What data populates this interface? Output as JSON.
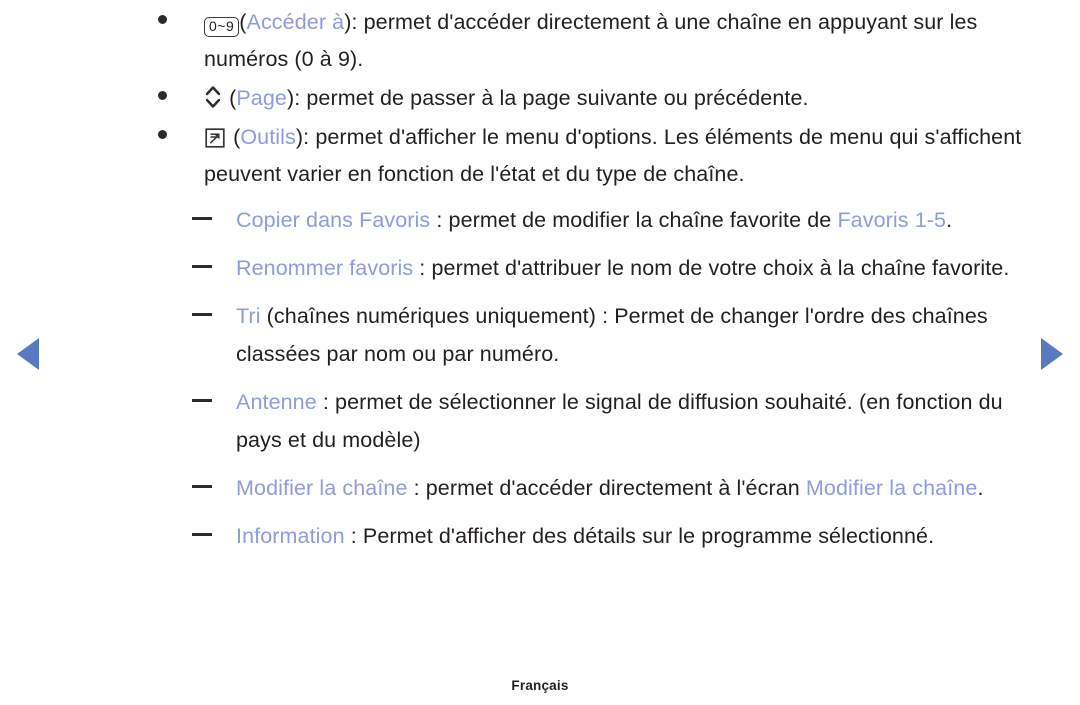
{
  "nav": {
    "prev_label": "Page précédente",
    "next_label": "Page suivante",
    "arrow_color": "#5a7ac0"
  },
  "theme": {
    "highlight_color": "#8d9cdc",
    "text_color": "#231f20",
    "background": "#ffffff"
  },
  "bullets": [
    {
      "icon": "numeric-keypad-icon",
      "icon_text": "0~9",
      "term": "Accéder à",
      "text_before": "(",
      "text_after": "): permet d'accéder directement à une chaîne en appuyant sur les numéros (0 à 9)."
    },
    {
      "icon": "page-up-down-icon",
      "icon_text": "",
      "term": "Page",
      "text_before": "(",
      "text_after": "): permet de passer à la page suivante ou précédente."
    },
    {
      "icon": "tools-icon",
      "icon_text": "",
      "term": "Outils",
      "text_before": "(",
      "text_after": "): permet d'afficher le menu d'options. Les éléments de menu qui s'affichent peuvent varier en fonction de l'état et du type de chaîne."
    }
  ],
  "sub_items": [
    {
      "term": "Copier dans Favoris",
      "body_1": " : permet de modifier la chaîne favorite de ",
      "term_2": "Favoris 1-5",
      "body_2": "."
    },
    {
      "term": "Renommer favoris",
      "body_1": " : permet d'attribuer le nom de votre choix à la chaîne favorite.",
      "term_2": "",
      "body_2": ""
    },
    {
      "term": "Tri",
      "body_1": " (chaînes numériques uniquement) : Permet de changer l'ordre des chaînes classées par nom ou par numéro.",
      "term_2": "",
      "body_2": ""
    },
    {
      "term": "Antenne",
      "body_1": " : permet de sélectionner le signal de diffusion souhaité. (en fonction du pays et du modèle)",
      "term_2": "",
      "body_2": ""
    },
    {
      "term": "Modifier la chaîne",
      "body_1": " : permet d'accéder directement à l'écran ",
      "term_2": "Modifier la chaîne",
      "body_2": "."
    },
    {
      "term": "Information",
      "body_1": " : Permet d'afficher des détails sur le programme sélectionné.",
      "term_2": "",
      "body_2": ""
    }
  ],
  "footer": {
    "language": "Français"
  }
}
